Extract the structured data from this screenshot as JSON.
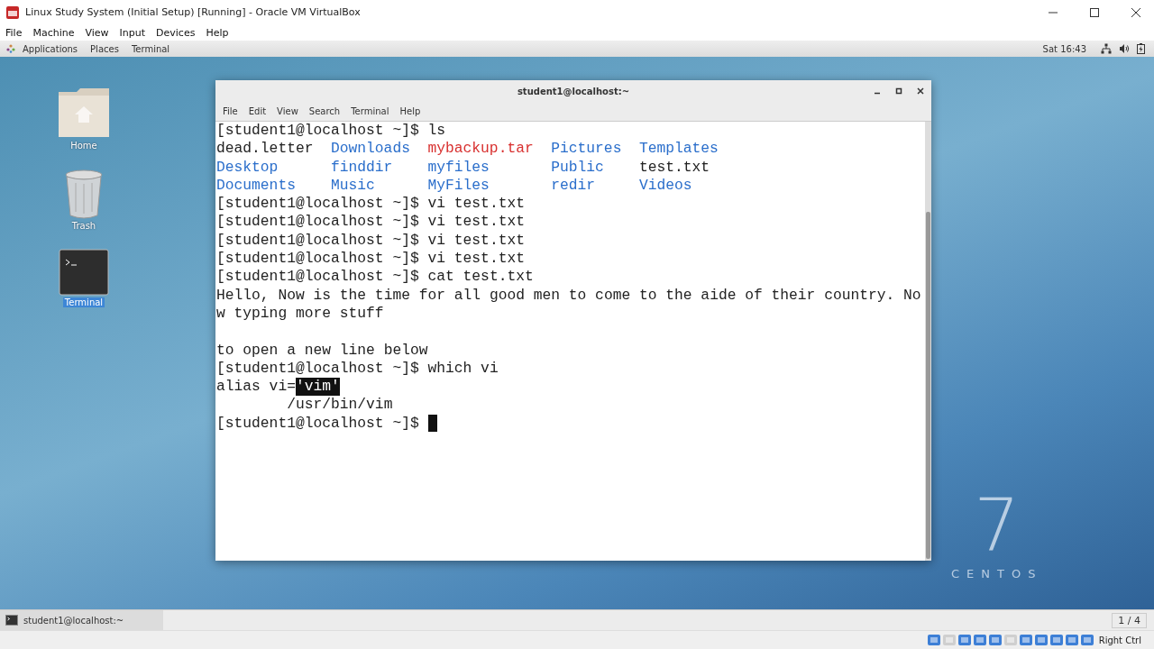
{
  "vbox": {
    "title": "Linux Study System (Initial Setup) [Running] - Oracle VM VirtualBox",
    "menu": [
      "File",
      "Machine",
      "View",
      "Input",
      "Devices",
      "Help"
    ],
    "host_key": "Right Ctrl"
  },
  "top_bar": {
    "menus": [
      "Applications",
      "Places",
      "Terminal"
    ],
    "clock": "Sat 16:43"
  },
  "desktop_icons": [
    {
      "label": "Home",
      "kind": "folder",
      "selected": false
    },
    {
      "label": "Trash",
      "kind": "trash",
      "selected": false
    },
    {
      "label": "Terminal",
      "kind": "terminal",
      "selected": true
    }
  ],
  "wallpaper_logo": {
    "number": "7",
    "word": "CENTOS"
  },
  "terminal": {
    "title": "student1@localhost:~",
    "menu": [
      "File",
      "Edit",
      "View",
      "Search",
      "Terminal",
      "Help"
    ],
    "lines": [
      {
        "kind": "plain",
        "text": "[student1@localhost ~]$ ls"
      },
      {
        "kind": "columns",
        "cells": [
          {
            "text": "dead.letter",
            "color": "#222222"
          },
          {
            "text": "Downloads",
            "color": "#2a6ecb"
          },
          {
            "text": "mybackup.tar",
            "color": "#d8302f"
          },
          {
            "text": "Pictures",
            "color": "#2a6ecb"
          },
          {
            "text": "Templates",
            "color": "#2a6ecb"
          }
        ]
      },
      {
        "kind": "columns",
        "cells": [
          {
            "text": "Desktop",
            "color": "#2a6ecb"
          },
          {
            "text": "finddir",
            "color": "#2a6ecb"
          },
          {
            "text": "myfiles",
            "color": "#2a6ecb"
          },
          {
            "text": "Public",
            "color": "#2a6ecb"
          },
          {
            "text": "test.txt",
            "color": "#222222"
          }
        ]
      },
      {
        "kind": "columns",
        "cells": [
          {
            "text": "Documents",
            "color": "#2a6ecb"
          },
          {
            "text": "Music",
            "color": "#2a6ecb"
          },
          {
            "text": "MyFiles",
            "color": "#2a6ecb"
          },
          {
            "text": "redir",
            "color": "#2a6ecb"
          },
          {
            "text": "Videos",
            "color": "#2a6ecb"
          }
        ]
      },
      {
        "kind": "plain",
        "text": "[student1@localhost ~]$ vi test.txt"
      },
      {
        "kind": "plain",
        "text": "[student1@localhost ~]$ vi test.txt"
      },
      {
        "kind": "plain",
        "text": "[student1@localhost ~]$ vi test.txt"
      },
      {
        "kind": "plain",
        "text": "[student1@localhost ~]$ vi test.txt"
      },
      {
        "kind": "plain",
        "text": "[student1@localhost ~]$ cat test.txt"
      },
      {
        "kind": "plain",
        "text": "Hello, Now is the time for all good men to come to the aide of their country. No"
      },
      {
        "kind": "plain",
        "text": "w typing more stuff"
      },
      {
        "kind": "plain",
        "text": "to open a new line below",
        "gap_before": true
      },
      {
        "kind": "plain",
        "text": "[student1@localhost ~]$ which vi"
      },
      {
        "kind": "parts",
        "parts": [
          {
            "text": "alias vi=",
            "selected": false
          },
          {
            "text": "'vim'",
            "selected": true
          }
        ]
      },
      {
        "kind": "plain",
        "text": "        /usr/bin/vim"
      },
      {
        "kind": "plain",
        "text": "[student1@localhost ~]$ ",
        "cursor": true
      }
    ]
  },
  "taskbar": {
    "tasks": [
      {
        "label": "student1@localhost:~",
        "selected": true
      }
    ],
    "workspace": "1 / 4"
  }
}
